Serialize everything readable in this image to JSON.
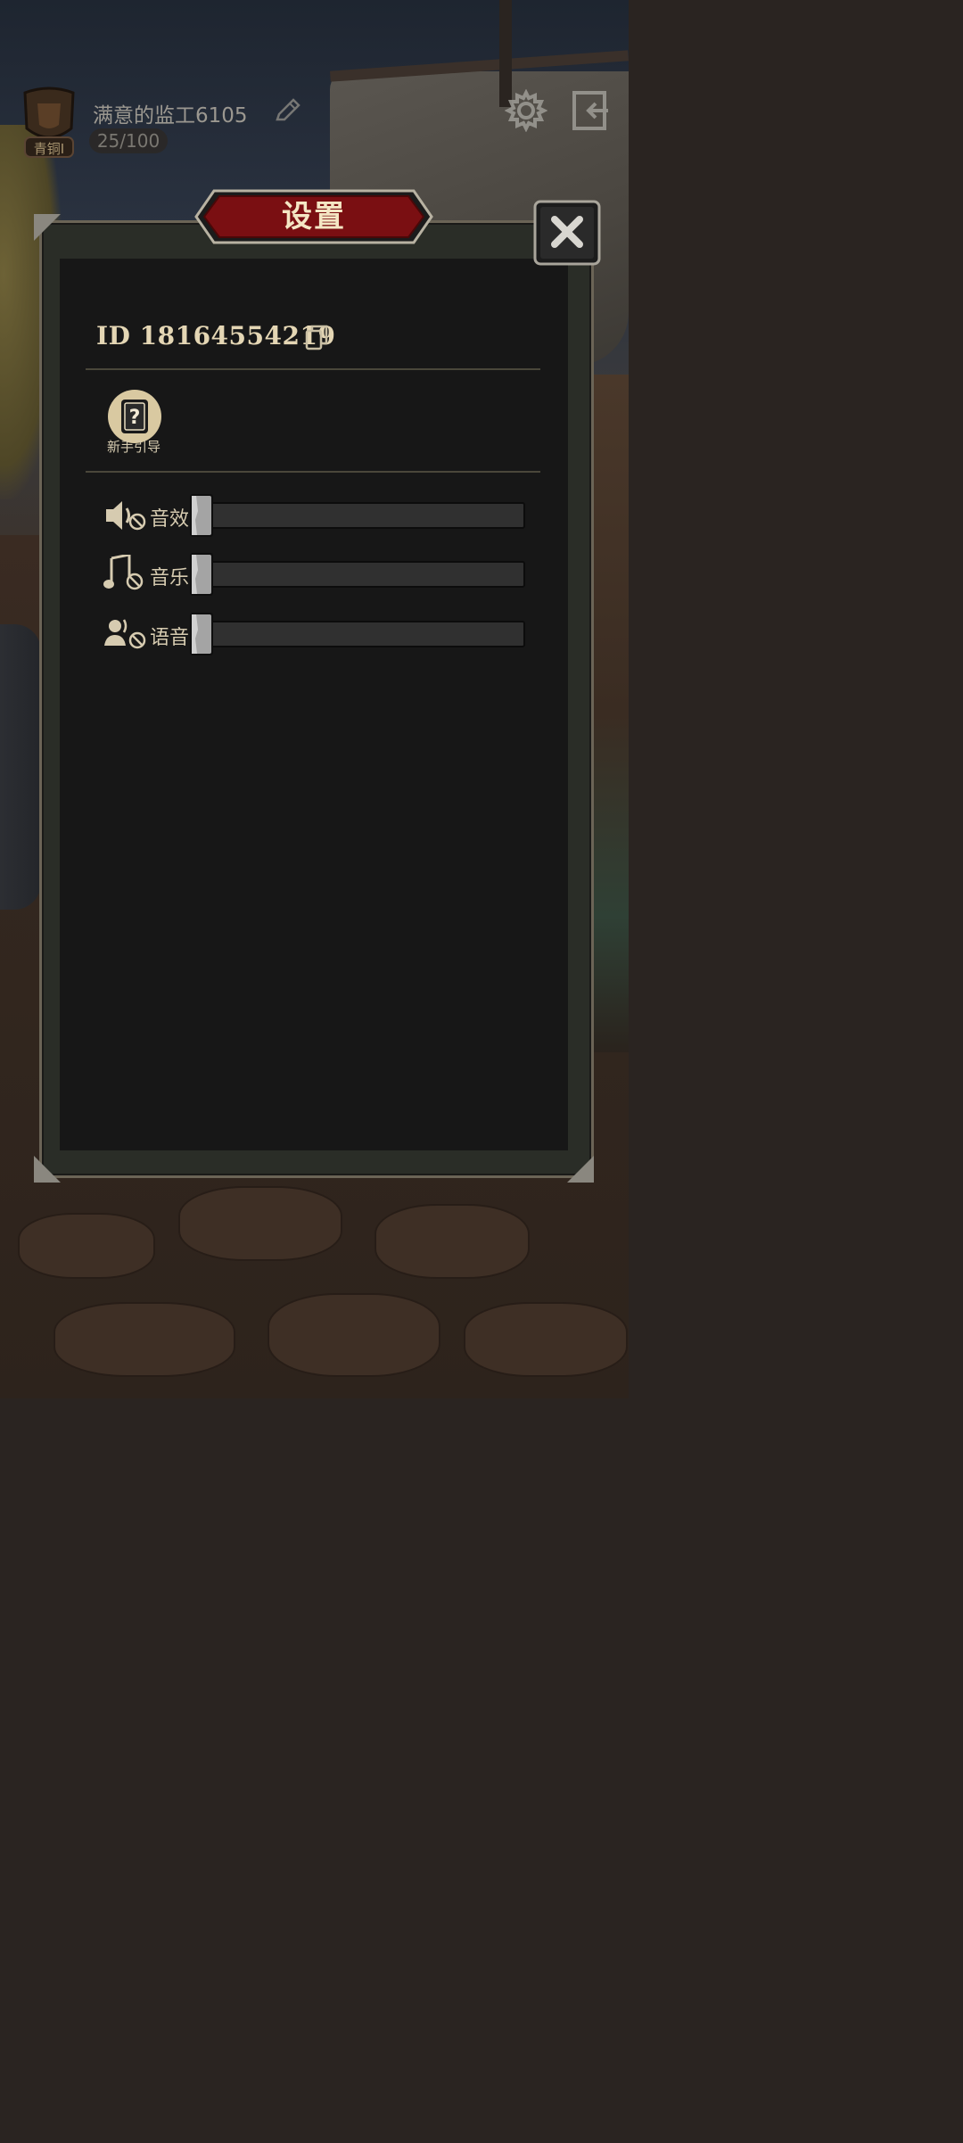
{
  "hud": {
    "player_name": "满意的监工6105",
    "rank_label": "青铜I",
    "xp_text": "25/100"
  },
  "dialog": {
    "title": "设置",
    "id_text": "ID 18164554219",
    "guide_label": "新手引导"
  },
  "audio": [
    {
      "label": "音效",
      "icon": "speaker-muted-icon",
      "level": 0
    },
    {
      "label": "音乐",
      "icon": "music-muted-icon",
      "level": 0
    },
    {
      "label": "语音",
      "icon": "voice-muted-icon",
      "level": 0
    }
  ],
  "colors": {
    "panel_bg": "#171717",
    "title_red": "#7a0f12",
    "text_cream": "#d6cbb0"
  }
}
